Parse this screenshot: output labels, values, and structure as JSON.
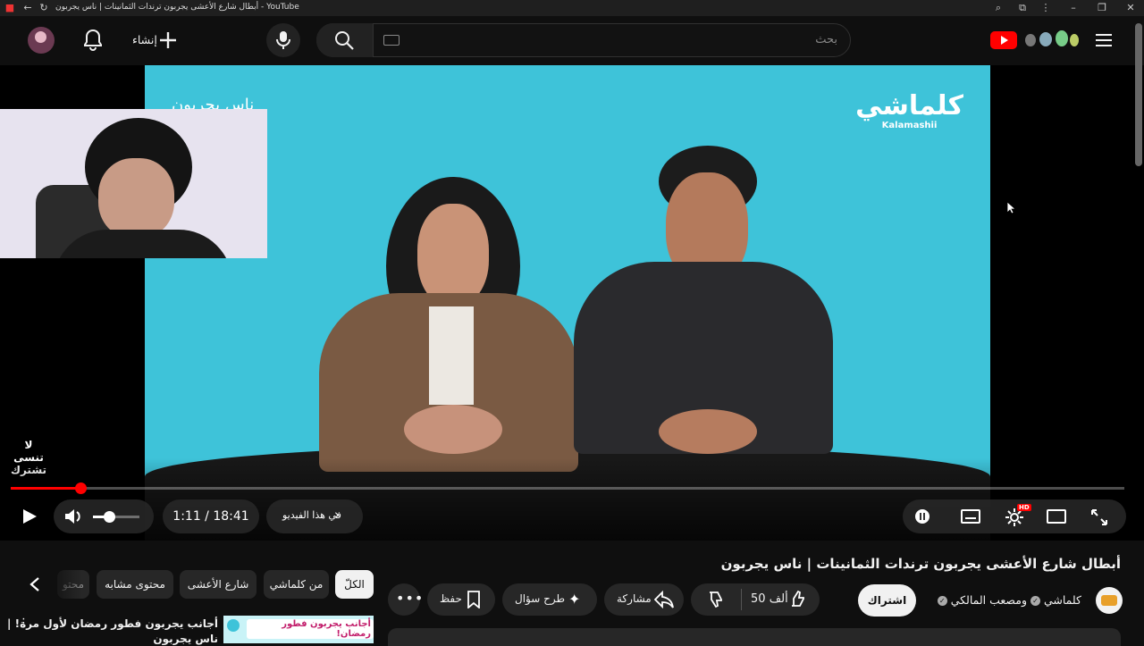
{
  "window": {
    "title": "أبطال شارع الأعشى يجربون ترندات الثمانينات | ناس يجربون - YouTube"
  },
  "masthead": {
    "search_placeholder": "بحث",
    "create_label": "إنشاء",
    "icons": [
      "menu-icon",
      "youtube-logo-icon",
      "keyboard-icon",
      "search-icon",
      "mic-icon",
      "plus-icon",
      "bell-icon",
      "avatar"
    ]
  },
  "video": {
    "brand_ar": "كلماشي",
    "brand_en": "Kalamashii",
    "series_partial": "ناس يجربون",
    "subscribe_reminder": "لا تنسى تشترك"
  },
  "controls": {
    "time_current": "1:11",
    "time_separator": " / ",
    "time_total": "18:41",
    "chapters_label": "في هذا الفيديو",
    "progress_fraction": 0.063,
    "volume_fraction": 0.35,
    "hd_badge": "HD"
  },
  "details": {
    "title": "أبطال شارع الأعشى يجربون ترندات الثمانينات | ناس يجربون",
    "channel_primary": "كلماشي",
    "channel_connector": "و",
    "channel_secondary": "مصعب المالكي",
    "subscribe_label": "اشتراك",
    "likes": "50 ألف",
    "share_label": "مشاركة",
    "ask_label": "طرح سؤال",
    "save_label": "حفظ"
  },
  "chips": [
    "الكلّ",
    "من كلماشي",
    "شارع الأعشى",
    "محتوى مشابه",
    "محتو"
  ],
  "recommendation": {
    "title": "أجانب يجربون فطور رمضان لأول مرة! |",
    "thumb_text": "أجانب يجربون فطور رمضان!",
    "second_line": "ناس يجربون"
  },
  "colors": {
    "accent_red": "#ff0000",
    "video_bg": "#3ec3d9",
    "page_bg": "#0f0f0f",
    "chip_bg": "#272727"
  }
}
